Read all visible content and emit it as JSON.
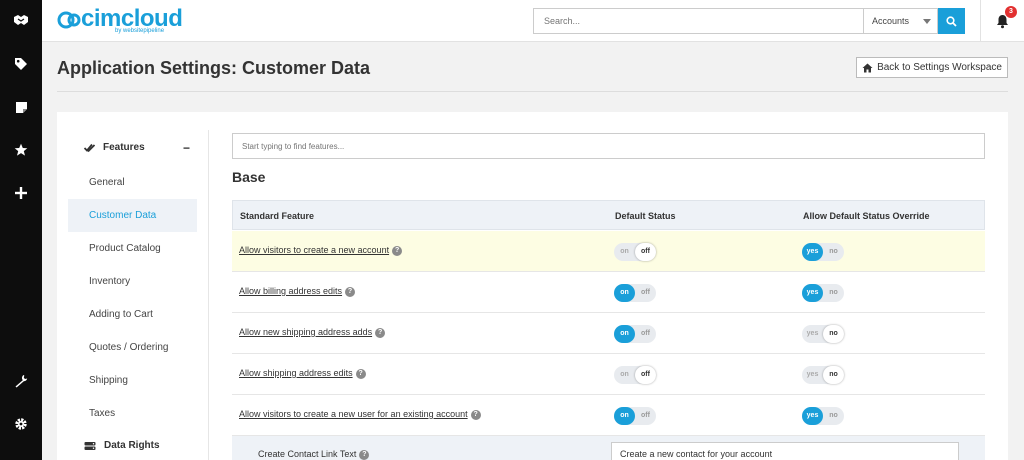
{
  "app": {
    "logo_text": "cimcloud",
    "logo_subtext": "by websitepipeline",
    "brand_color": "#1a9fd9"
  },
  "rail": {
    "icons": [
      "handshake-icon",
      "tag-icon",
      "note-icon",
      "star-icon",
      "plus-icon",
      "wrench-icon",
      "gear-icon"
    ]
  },
  "header": {
    "search_placeholder": "Search...",
    "scope_selected": "Accounts",
    "notification_count": "3"
  },
  "page": {
    "title": "Application Settings: Customer Data",
    "back_button": "Back to Settings Workspace"
  },
  "sidebar": {
    "section_label": "Features",
    "collapse_symbol": "−",
    "items": [
      {
        "label": "General",
        "active": false
      },
      {
        "label": "Customer Data",
        "active": true
      },
      {
        "label": "Product Catalog",
        "active": false
      },
      {
        "label": "Inventory",
        "active": false
      },
      {
        "label": "Adding to Cart",
        "active": false
      },
      {
        "label": "Quotes / Ordering",
        "active": false
      },
      {
        "label": "Shipping",
        "active": false
      },
      {
        "label": "Taxes",
        "active": false
      }
    ],
    "section2_label": "Data Rights"
  },
  "content": {
    "feature_search_placeholder": "Start typing to find features...",
    "section_title": "Base",
    "columns": [
      "Standard Feature",
      "Default Status",
      "Allow Default Status Override"
    ],
    "default_labels": [
      "on",
      "off"
    ],
    "override_labels": [
      "yes",
      "no"
    ],
    "rows": [
      {
        "feature": "Allow visitors to create a new account",
        "default_status": "off",
        "allow_override": "yes",
        "highlighted": true
      },
      {
        "feature": "Allow billing address edits",
        "default_status": "on",
        "allow_override": "yes",
        "highlighted": false
      },
      {
        "feature": "Allow new shipping address adds",
        "default_status": "on",
        "allow_override": "no",
        "highlighted": false
      },
      {
        "feature": "Allow shipping address edits",
        "default_status": "off",
        "allow_override": "no",
        "highlighted": false
      },
      {
        "feature": "Allow visitors to create a new user for an existing account",
        "default_status": "on",
        "allow_override": "yes",
        "highlighted": false
      }
    ],
    "sub_setting": {
      "label": "Create Contact Link Text",
      "value": "Create a new contact for your account"
    }
  }
}
